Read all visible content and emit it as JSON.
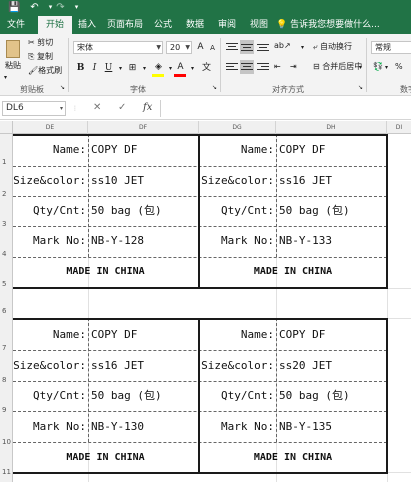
{
  "quick_access": {
    "save": "💾",
    "undo": "↶",
    "redo": "↷"
  },
  "menu": {
    "tabs": [
      "文件",
      "开始",
      "插入",
      "页面布局",
      "公式",
      "数据",
      "审阅",
      "视图"
    ],
    "active": "开始",
    "tell_me": "告诉我您想要做什么..."
  },
  "ribbon": {
    "clipboard": {
      "paste": "粘贴",
      "cut": "剪切",
      "copy": "复制",
      "format_painter": "格式刷",
      "label": "剪贴板"
    },
    "font": {
      "name": "宋体",
      "size": "20",
      "grow": "A",
      "shrink": "A",
      "bold": "B",
      "italic": "I",
      "underline": "U",
      "label": "字体"
    },
    "alignment": {
      "wrap": "自动换行",
      "merge": "合并后居中",
      "label": "对齐方式"
    },
    "number": {
      "format": "常规",
      "label": "数字"
    }
  },
  "formula_bar": {
    "name_box": "DL6",
    "cancel": "✕",
    "enter": "✓",
    "fx": "fx",
    "value": ""
  },
  "columns": [
    "DE",
    "DF",
    "DG",
    "DH",
    "DI"
  ],
  "rows": [
    "1",
    "2",
    "3",
    "4",
    "5",
    "6",
    "7",
    "8",
    "9",
    "10",
    "11"
  ],
  "labels": {
    "name": "Name:",
    "size": "Size&color:",
    "qty": "Qty/Cnt:",
    "mark": "Mark No:",
    "made": "MADE IN CHINA"
  },
  "labels_set": [
    {
      "name": "COPY DF",
      "size": "ss10 JET",
      "qty": "50 bag (包)",
      "mark": "NB-Y-128"
    },
    {
      "name": "COPY DF",
      "size": "ss16 JET",
      "qty": "50 bag (包)",
      "mark": "NB-Y-133"
    },
    {
      "name": "COPY DF",
      "size": "ss16 JET",
      "qty": "50 bag (包)",
      "mark": "NB-Y-130"
    },
    {
      "name": "COPY DF",
      "size": "ss20 JET",
      "qty": "50 bag (包)",
      "mark": "NB-Y-135"
    }
  ]
}
